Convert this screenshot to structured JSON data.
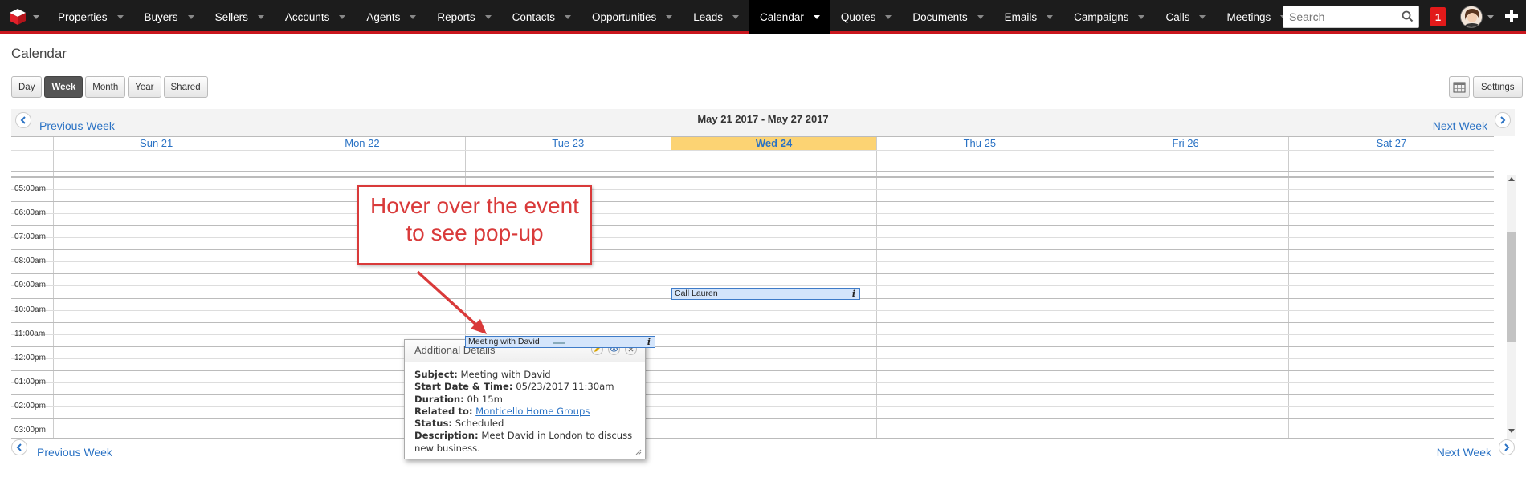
{
  "colors": {
    "accent_red": "#c9161d",
    "link_blue": "#2a72c4",
    "today_yellow": "#fcd373",
    "event_fill": "#d4e5fb",
    "callout_red": "#d93a3a"
  },
  "nav": {
    "items": [
      "Properties",
      "Buyers",
      "Sellers",
      "Accounts",
      "Agents",
      "Reports",
      "Contacts",
      "Opportunities",
      "Leads",
      "Calendar",
      "Quotes",
      "Documents",
      "Emails",
      "Campaigns",
      "Calls",
      "Meetings"
    ],
    "active": "Calendar",
    "more_icon": "chevron-down-icon",
    "search_placeholder": "Search",
    "notifications": "1"
  },
  "page": {
    "title": "Calendar"
  },
  "views": [
    "Day",
    "Week",
    "Month",
    "Year",
    "Shared"
  ],
  "active_view": "Week",
  "settings_label": "Settings",
  "week": {
    "prev_label": "Previous Week",
    "next_label": "Next Week",
    "range": "May 21 2017 - May 27 2017",
    "days": [
      "Sun 21",
      "Mon 22",
      "Tue 23",
      "Wed 24",
      "Thu 25",
      "Fri 26",
      "Sat 27"
    ],
    "today": "Wed 24"
  },
  "times": [
    "05:00am",
    "06:00am",
    "07:00am",
    "08:00am",
    "09:00am",
    "10:00am",
    "11:00am",
    "12:00pm",
    "01:00pm",
    "02:00pm",
    "03:00pm"
  ],
  "events": [
    {
      "title": "Call Lauren",
      "day": "Wed 24",
      "time": "09:30am"
    },
    {
      "title": "Meeting with David",
      "day": "Tue 23",
      "time": "11:30am"
    }
  ],
  "popup": {
    "title": "Additional Details",
    "subject_label": "Subject:",
    "subject": "Meeting with David",
    "start_label": "Start Date & Time:",
    "start": "05/23/2017 11:30am",
    "duration_label": "Duration:",
    "duration": "0h 15m",
    "related_label": "Related to:",
    "related": "Monticello Home Groups",
    "status_label": "Status:",
    "status": "Scheduled",
    "description_label": "Description:",
    "description": "Meet David in London to discuss new business."
  },
  "callout": {
    "line1": "Hover over the event",
    "line2": "to see pop-up"
  }
}
